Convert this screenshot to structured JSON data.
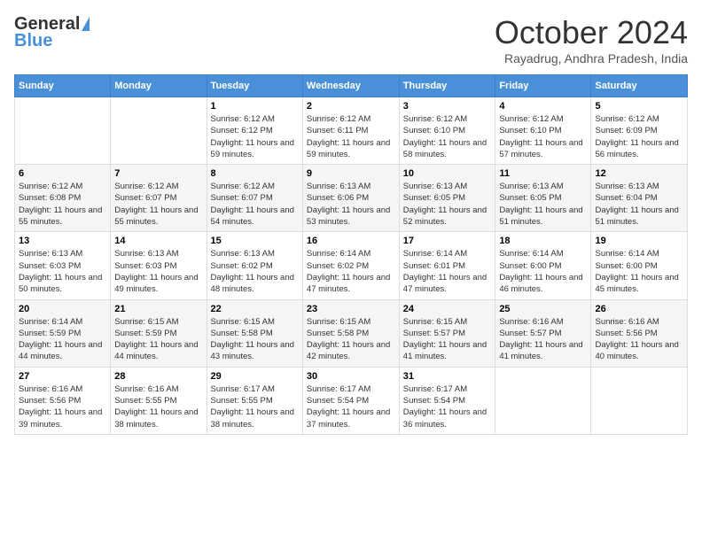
{
  "logo": {
    "general": "General",
    "blue": "Blue"
  },
  "title": "October 2024",
  "subtitle": "Rayadrug, Andhra Pradesh, India",
  "weekdays": [
    "Sunday",
    "Monday",
    "Tuesday",
    "Wednesday",
    "Thursday",
    "Friday",
    "Saturday"
  ],
  "days": [
    {
      "num": "",
      "sunrise": "",
      "sunset": "",
      "daylight": ""
    },
    {
      "num": "",
      "sunrise": "",
      "sunset": "",
      "daylight": ""
    },
    {
      "num": "1",
      "sunrise": "Sunrise: 6:12 AM",
      "sunset": "Sunset: 6:12 PM",
      "daylight": "Daylight: 11 hours and 59 minutes."
    },
    {
      "num": "2",
      "sunrise": "Sunrise: 6:12 AM",
      "sunset": "Sunset: 6:11 PM",
      "daylight": "Daylight: 11 hours and 59 minutes."
    },
    {
      "num": "3",
      "sunrise": "Sunrise: 6:12 AM",
      "sunset": "Sunset: 6:10 PM",
      "daylight": "Daylight: 11 hours and 58 minutes."
    },
    {
      "num": "4",
      "sunrise": "Sunrise: 6:12 AM",
      "sunset": "Sunset: 6:10 PM",
      "daylight": "Daylight: 11 hours and 57 minutes."
    },
    {
      "num": "5",
      "sunrise": "Sunrise: 6:12 AM",
      "sunset": "Sunset: 6:09 PM",
      "daylight": "Daylight: 11 hours and 56 minutes."
    },
    {
      "num": "6",
      "sunrise": "Sunrise: 6:12 AM",
      "sunset": "Sunset: 6:08 PM",
      "daylight": "Daylight: 11 hours and 55 minutes."
    },
    {
      "num": "7",
      "sunrise": "Sunrise: 6:12 AM",
      "sunset": "Sunset: 6:07 PM",
      "daylight": "Daylight: 11 hours and 55 minutes."
    },
    {
      "num": "8",
      "sunrise": "Sunrise: 6:12 AM",
      "sunset": "Sunset: 6:07 PM",
      "daylight": "Daylight: 11 hours and 54 minutes."
    },
    {
      "num": "9",
      "sunrise": "Sunrise: 6:13 AM",
      "sunset": "Sunset: 6:06 PM",
      "daylight": "Daylight: 11 hours and 53 minutes."
    },
    {
      "num": "10",
      "sunrise": "Sunrise: 6:13 AM",
      "sunset": "Sunset: 6:05 PM",
      "daylight": "Daylight: 11 hours and 52 minutes."
    },
    {
      "num": "11",
      "sunrise": "Sunrise: 6:13 AM",
      "sunset": "Sunset: 6:05 PM",
      "daylight": "Daylight: 11 hours and 51 minutes."
    },
    {
      "num": "12",
      "sunrise": "Sunrise: 6:13 AM",
      "sunset": "Sunset: 6:04 PM",
      "daylight": "Daylight: 11 hours and 51 minutes."
    },
    {
      "num": "13",
      "sunrise": "Sunrise: 6:13 AM",
      "sunset": "Sunset: 6:03 PM",
      "daylight": "Daylight: 11 hours and 50 minutes."
    },
    {
      "num": "14",
      "sunrise": "Sunrise: 6:13 AM",
      "sunset": "Sunset: 6:03 PM",
      "daylight": "Daylight: 11 hours and 49 minutes."
    },
    {
      "num": "15",
      "sunrise": "Sunrise: 6:13 AM",
      "sunset": "Sunset: 6:02 PM",
      "daylight": "Daylight: 11 hours and 48 minutes."
    },
    {
      "num": "16",
      "sunrise": "Sunrise: 6:14 AM",
      "sunset": "Sunset: 6:02 PM",
      "daylight": "Daylight: 11 hours and 47 minutes."
    },
    {
      "num": "17",
      "sunrise": "Sunrise: 6:14 AM",
      "sunset": "Sunset: 6:01 PM",
      "daylight": "Daylight: 11 hours and 47 minutes."
    },
    {
      "num": "18",
      "sunrise": "Sunrise: 6:14 AM",
      "sunset": "Sunset: 6:00 PM",
      "daylight": "Daylight: 11 hours and 46 minutes."
    },
    {
      "num": "19",
      "sunrise": "Sunrise: 6:14 AM",
      "sunset": "Sunset: 6:00 PM",
      "daylight": "Daylight: 11 hours and 45 minutes."
    },
    {
      "num": "20",
      "sunrise": "Sunrise: 6:14 AM",
      "sunset": "Sunset: 5:59 PM",
      "daylight": "Daylight: 11 hours and 44 minutes."
    },
    {
      "num": "21",
      "sunrise": "Sunrise: 6:15 AM",
      "sunset": "Sunset: 5:59 PM",
      "daylight": "Daylight: 11 hours and 44 minutes."
    },
    {
      "num": "22",
      "sunrise": "Sunrise: 6:15 AM",
      "sunset": "Sunset: 5:58 PM",
      "daylight": "Daylight: 11 hours and 43 minutes."
    },
    {
      "num": "23",
      "sunrise": "Sunrise: 6:15 AM",
      "sunset": "Sunset: 5:58 PM",
      "daylight": "Daylight: 11 hours and 42 minutes."
    },
    {
      "num": "24",
      "sunrise": "Sunrise: 6:15 AM",
      "sunset": "Sunset: 5:57 PM",
      "daylight": "Daylight: 11 hours and 41 minutes."
    },
    {
      "num": "25",
      "sunrise": "Sunrise: 6:16 AM",
      "sunset": "Sunset: 5:57 PM",
      "daylight": "Daylight: 11 hours and 41 minutes."
    },
    {
      "num": "26",
      "sunrise": "Sunrise: 6:16 AM",
      "sunset": "Sunset: 5:56 PM",
      "daylight": "Daylight: 11 hours and 40 minutes."
    },
    {
      "num": "27",
      "sunrise": "Sunrise: 6:16 AM",
      "sunset": "Sunset: 5:56 PM",
      "daylight": "Daylight: 11 hours and 39 minutes."
    },
    {
      "num": "28",
      "sunrise": "Sunrise: 6:16 AM",
      "sunset": "Sunset: 5:55 PM",
      "daylight": "Daylight: 11 hours and 38 minutes."
    },
    {
      "num": "29",
      "sunrise": "Sunrise: 6:17 AM",
      "sunset": "Sunset: 5:55 PM",
      "daylight": "Daylight: 11 hours and 38 minutes."
    },
    {
      "num": "30",
      "sunrise": "Sunrise: 6:17 AM",
      "sunset": "Sunset: 5:54 PM",
      "daylight": "Daylight: 11 hours and 37 minutes."
    },
    {
      "num": "31",
      "sunrise": "Sunrise: 6:17 AM",
      "sunset": "Sunset: 5:54 PM",
      "daylight": "Daylight: 11 hours and 36 minutes."
    },
    {
      "num": "",
      "sunrise": "",
      "sunset": "",
      "daylight": ""
    },
    {
      "num": "",
      "sunrise": "",
      "sunset": "",
      "daylight": ""
    }
  ]
}
